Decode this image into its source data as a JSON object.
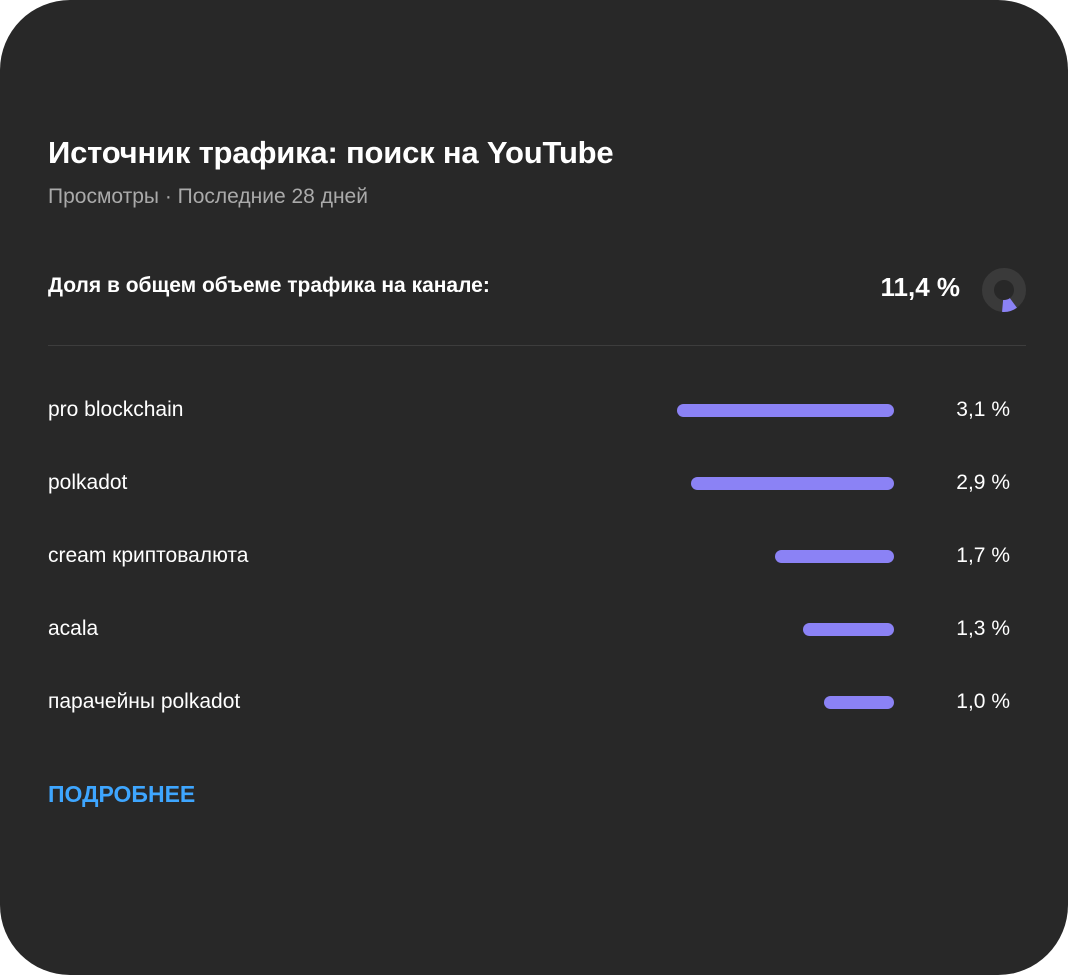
{
  "card": {
    "title": "Источник трафика: поиск на YouTube",
    "subtitle": "Просмотры · Последние 28 дней"
  },
  "share": {
    "label": "Доля в общем объеме трафика на канале:",
    "value": "11,4 %",
    "fraction": 0.114
  },
  "rows": [
    {
      "label": "pro blockchain",
      "value": "3,1 %",
      "percent": 3.1
    },
    {
      "label": "polkadot",
      "value": "2,9 %",
      "percent": 2.9
    },
    {
      "label": "cream криптовалюта",
      "value": "1,7 %",
      "percent": 1.7
    },
    {
      "label": "acala",
      "value": "1,3 %",
      "percent": 1.3
    },
    {
      "label": "парачейны polkadot",
      "value": "1,0 %",
      "percent": 1.0
    }
  ],
  "more_label": "ПОДРОБНЕЕ",
  "colors": {
    "card_bg": "#282828",
    "bar": "#8b82f5",
    "donut_track": "#3a3a3a",
    "link": "#3ea6ff",
    "muted_text": "#aaaaaa"
  },
  "icons": {
    "share": "donut-chart-icon"
  }
}
